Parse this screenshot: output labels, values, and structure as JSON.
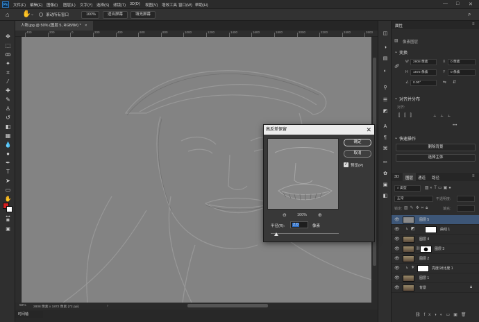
{
  "app": {
    "logo": "Ps",
    "menu": [
      "文件(F)",
      "编辑(E)",
      "图像(I)",
      "图层(L)",
      "文字(Y)",
      "选择(S)",
      "滤镜(T)",
      "3D(D)",
      "视图(V)",
      "增效工具",
      "窗口(W)",
      "帮助(H)"
    ],
    "window_controls": [
      "—",
      "□",
      "✕"
    ]
  },
  "options_bar": {
    "scroll_all_label": "滚动所有窗口",
    "zoom_value": "100%",
    "fit_screen": "适合屏幕",
    "fill_screen": "填充屏幕"
  },
  "document": {
    "tab_title": "人物.jpg @ 50% (图层 5, RGB/8#) *",
    "tab_close": "×",
    "ruler_labels": [
      "400",
      "200",
      "0",
      "200",
      "400",
      "600",
      "800",
      "1000",
      "1200",
      "1400",
      "1600",
      "1800",
      "2000",
      "2200",
      "2400",
      "2600"
    ],
    "status": {
      "zoom": "50%",
      "info": "2808 像素 x 1872 像素 (72 ppi)"
    },
    "timeline_label": "时间轴"
  },
  "dialog": {
    "title": "高反差保留",
    "close": "✕",
    "ok": "确定",
    "cancel": "取消",
    "preview_label": "预览(P)",
    "preview_checked": true,
    "zoom_out": "⊖",
    "zoom_in": "⊕",
    "zoom_level": "100%",
    "radius_label": "半径(R):",
    "radius_value": "2.0",
    "radius_unit": "像素"
  },
  "properties": {
    "tab": "属性",
    "layer_type": "像素图层",
    "transform_title": "变换",
    "w_label": "W",
    "w_value": "2808 像素",
    "h_label": "H",
    "h_value": "1872 像素",
    "x_label": "X",
    "x_value": "0 像素",
    "y_label": "Y",
    "y_value": "0 像素",
    "angle_value": "0.00°",
    "align_title": "对齐并分布",
    "align_sub": "对齐:",
    "quick_title": "快速操作",
    "quick_btn_1": "删除背景",
    "quick_btn_2": "选择主体"
  },
  "layers_panel": {
    "tabs": [
      "3D",
      "图层",
      "通道",
      "路径"
    ],
    "filter_label": "类型",
    "blend_mode": "正常",
    "opacity_label": "不透明度:",
    "lock_label": "锁定:",
    "fill_label": "填充:",
    "layers": [
      {
        "name": "图层 5",
        "selected": true
      },
      {
        "name": "曲线 1",
        "selected": false
      },
      {
        "name": "图层 4",
        "selected": false
      },
      {
        "name": "图层 3",
        "selected": false
      },
      {
        "name": "图层 2",
        "selected": false
      },
      {
        "name": "亮度/对比度 1",
        "selected": false
      },
      {
        "name": "图层 1",
        "selected": false
      },
      {
        "name": "背景",
        "selected": false
      }
    ]
  },
  "colors": {
    "foreground": "#d42020",
    "background": "#ffffff",
    "accent": "#2d82d8",
    "selected_layer": "#3d5677"
  }
}
